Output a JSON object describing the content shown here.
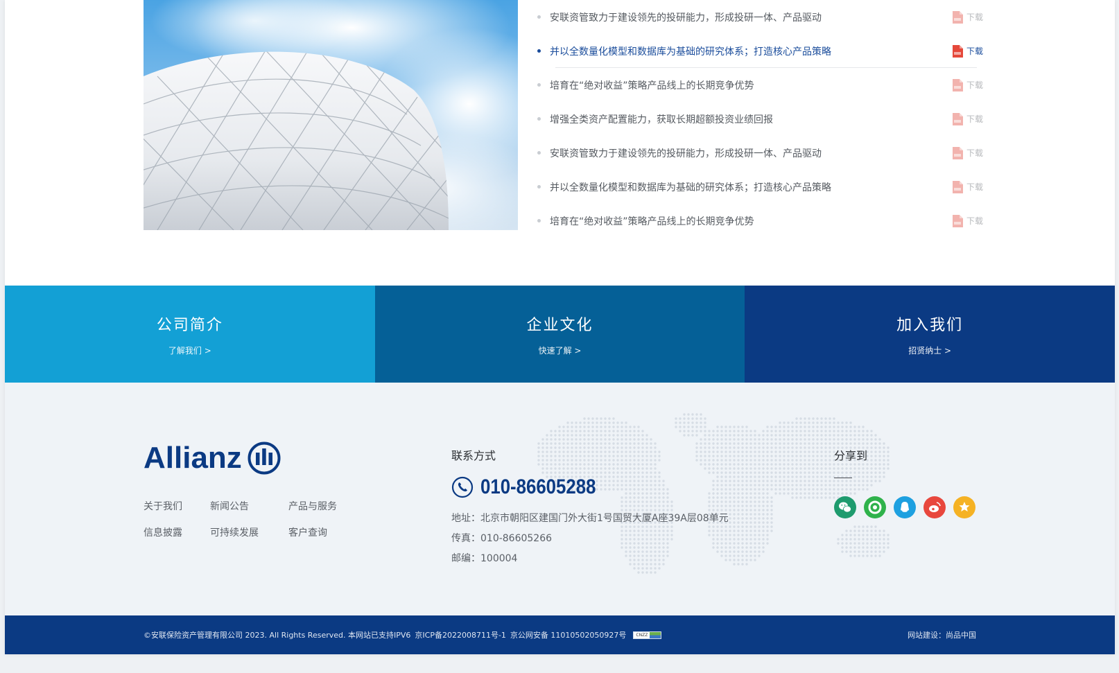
{
  "documents": [
    {
      "title": "安联资管致力于建设领先的投研能力，形成投研一体、产品驱动",
      "download": "下载",
      "active": false
    },
    {
      "title": "并以全数量化模型和数据库为基础的研究体系；打造核心产品策略",
      "download": "下载",
      "active": true
    },
    {
      "title": "培育在“绝对收益”策略产品线上的长期竞争优势",
      "download": "下载",
      "active": false
    },
    {
      "title": "增强全类资产配置能力，获取长期超额投资业绩回报",
      "download": "下载",
      "active": false
    },
    {
      "title": "安联资管致力于建设领先的投研能力，形成投研一体、产品驱动",
      "download": "下载",
      "active": false
    },
    {
      "title": "并以全数量化模型和数据库为基础的研究体系；打造核心产品策略",
      "download": "下载",
      "active": false
    },
    {
      "title": "培育在“绝对收益”策略产品线上的长期竞争优势",
      "download": "下载",
      "active": false
    }
  ],
  "bands": [
    {
      "title": "公司简介",
      "link": "了解我们 >",
      "color": "#13a0d5"
    },
    {
      "title": "企业文化",
      "link": "快速了解 >",
      "color": "#056097"
    },
    {
      "title": "加入我们",
      "link": "招贤纳士 >",
      "color": "#0b3a83"
    }
  ],
  "footer": {
    "logo_text": "Allianz",
    "nav": [
      "关于我们",
      "新闻公告",
      "产品与服务",
      "信息披露",
      "可持续发展",
      "客户查询"
    ],
    "contact": {
      "heading": "联系方式",
      "phone": "010-86605288",
      "address": "地址：北京市朝阳区建国门外大街1号国贸大厦A座39A层08单元",
      "fax": "传真：010-86605266",
      "postcode": "邮编：100004"
    },
    "share": {
      "heading": "分享到",
      "icons": [
        {
          "name": "wechat-icon",
          "color": "#1e9b6e"
        },
        {
          "name": "moments-icon",
          "color": "#2fb24b"
        },
        {
          "name": "qq-icon",
          "color": "#1ea0e0"
        },
        {
          "name": "weibo-icon",
          "color": "#e8473d"
        },
        {
          "name": "qzone-icon",
          "color": "#f5b224"
        }
      ]
    }
  },
  "bottom_bar": {
    "copyright": "©安联保险资产管理有限公司 2023. All Rights Reserved. 本网站已支持IPV6",
    "icp": "京ICP备2022008711号-1",
    "police": "京公网安备 11010502050927号",
    "badge": "CNZZ",
    "builder": "网站建设：尚品中国"
  },
  "colors": {
    "brand_blue": "#0b3a83",
    "active_link": "#1a4c9b",
    "pdf_red": "#e5483a",
    "pdf_red_muted": "#f2b3ae"
  }
}
